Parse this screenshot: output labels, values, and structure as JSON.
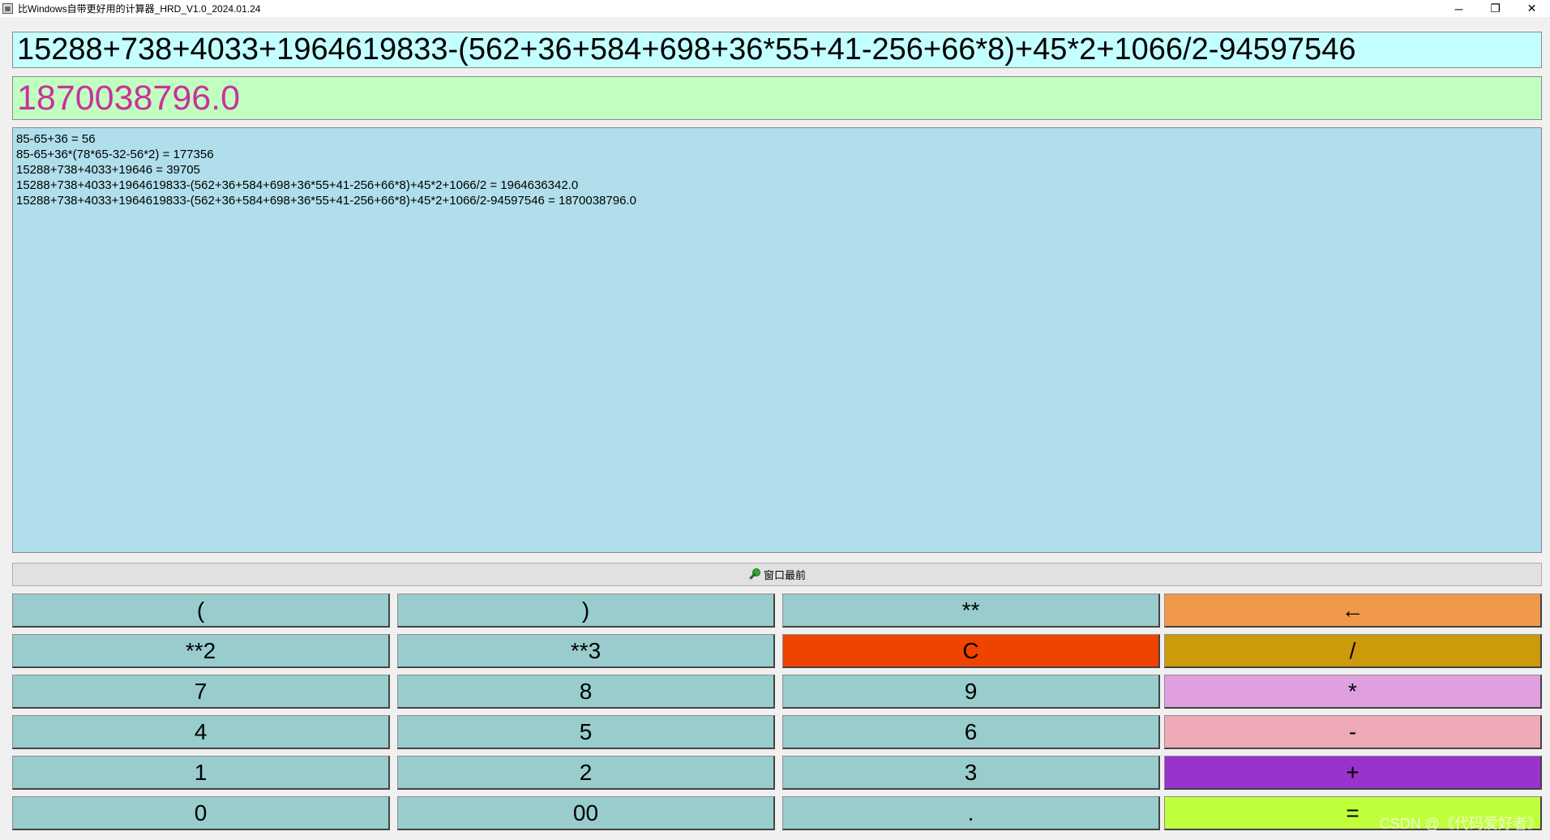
{
  "window": {
    "title": "比Windows自带更好用的计算器_HRD_V1.0_2024.01.24",
    "controls": {
      "minimize": "─",
      "restore": "❐",
      "close": "✕"
    }
  },
  "expression": "15288+738+4033+1964619833-(562+36+584+698+36*55+41-256+66*8)+45*2+1066/2-94597546",
  "result": "1870038796.0",
  "history": [
    "85-65+36 = 56",
    "85-65+36*(78*65-32-56*2) = 177356",
    "15288+738+4033+19646 = 39705",
    "15288+738+4033+1964619833-(562+36+584+698+36*55+41-256+66*8)+45*2+1066/2 = 1964636342.0",
    "15288+738+4033+1964619833-(562+36+584+698+36*55+41-256+66*8)+45*2+1066/2-94597546 = 1870038796.0"
  ],
  "topmost_button": {
    "label": "窗口最前",
    "icon": "pin-icon"
  },
  "keys": [
    [
      {
        "label": "(",
        "color": "#99cccc",
        "name": "key-open-paren"
      },
      {
        "label": ")",
        "color": "#99cccc",
        "name": "key-close-paren"
      },
      {
        "label": "**",
        "color": "#99cccc",
        "name": "key-power"
      },
      {
        "label": "←",
        "color": "#f0994a",
        "name": "key-backspace"
      }
    ],
    [
      {
        "label": "**2",
        "color": "#99cccc",
        "name": "key-square"
      },
      {
        "label": "**3",
        "color": "#99cccc",
        "name": "key-cube"
      },
      {
        "label": "C",
        "color": "#f04300",
        "name": "key-clear"
      },
      {
        "label": "/",
        "color": "#cc9a0a",
        "name": "key-divide"
      }
    ],
    [
      {
        "label": "7",
        "color": "#99cccc",
        "name": "key-7"
      },
      {
        "label": "8",
        "color": "#99cccc",
        "name": "key-8"
      },
      {
        "label": "9",
        "color": "#99cccc",
        "name": "key-9"
      },
      {
        "label": "*",
        "color": "#e0a0e0",
        "name": "key-multiply"
      }
    ],
    [
      {
        "label": "4",
        "color": "#99cccc",
        "name": "key-4"
      },
      {
        "label": "5",
        "color": "#99cccc",
        "name": "key-5"
      },
      {
        "label": "6",
        "color": "#99cccc",
        "name": "key-6"
      },
      {
        "label": "-",
        "color": "#eeaab6",
        "name": "key-subtract"
      }
    ],
    [
      {
        "label": "1",
        "color": "#99cccc",
        "name": "key-1"
      },
      {
        "label": "2",
        "color": "#99cccc",
        "name": "key-2"
      },
      {
        "label": "3",
        "color": "#99cccc",
        "name": "key-3"
      },
      {
        "label": "+",
        "color": "#9933cc",
        "name": "key-add"
      }
    ],
    [
      {
        "label": "0",
        "color": "#99cccc",
        "name": "key-0"
      },
      {
        "label": "00",
        "color": "#99cccc",
        "name": "key-00"
      },
      {
        "label": ".",
        "color": "#99cccc",
        "name": "key-decimal"
      },
      {
        "label": "=",
        "color": "#c0ff3c",
        "name": "key-equals"
      }
    ]
  ],
  "watermark": "CSDN @《代码爱好者》"
}
